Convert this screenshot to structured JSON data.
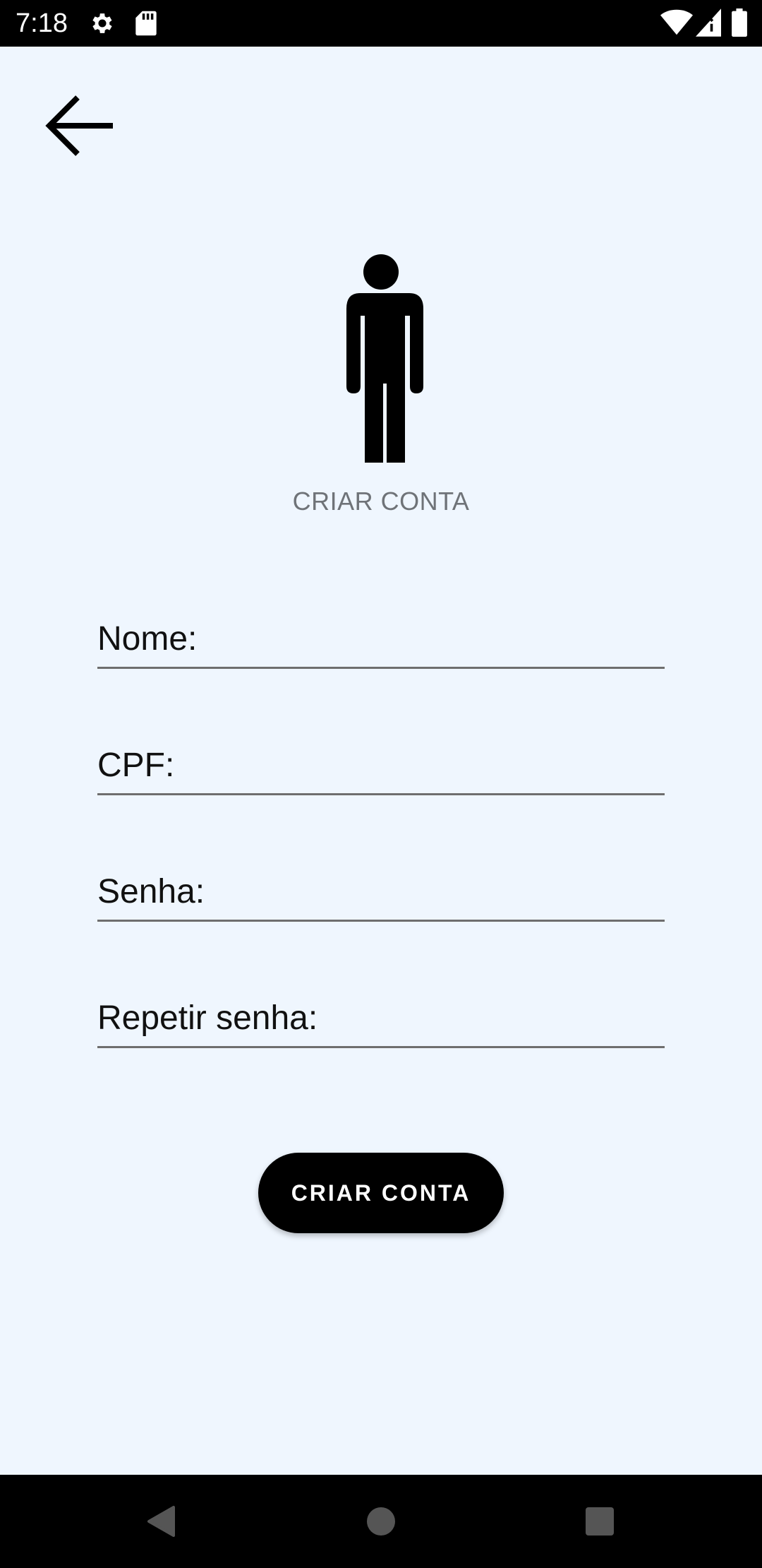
{
  "status_bar": {
    "time": "7:18",
    "icons": [
      "gear-icon",
      "sd-card-icon",
      "wifi-icon",
      "signal-icon",
      "battery-icon"
    ]
  },
  "header": {
    "back_icon": "arrow-back-icon"
  },
  "hero": {
    "icon": "person-icon",
    "title": "CRIAR CONTA"
  },
  "form": {
    "fields": [
      {
        "placeholder": "Nome:",
        "value": ""
      },
      {
        "placeholder": "CPF:",
        "value": ""
      },
      {
        "placeholder": "Senha:",
        "value": ""
      },
      {
        "placeholder": "Repetir senha:",
        "value": ""
      }
    ],
    "submit_label": "CRIAR CONTA"
  },
  "nav_bar": {
    "buttons": [
      "back-triangle-icon",
      "home-circle-icon",
      "recents-square-icon"
    ]
  },
  "colors": {
    "background": "#eff6fe",
    "primary": "#000000",
    "muted_text": "#6f7378",
    "underline": "#6e6e6e"
  }
}
